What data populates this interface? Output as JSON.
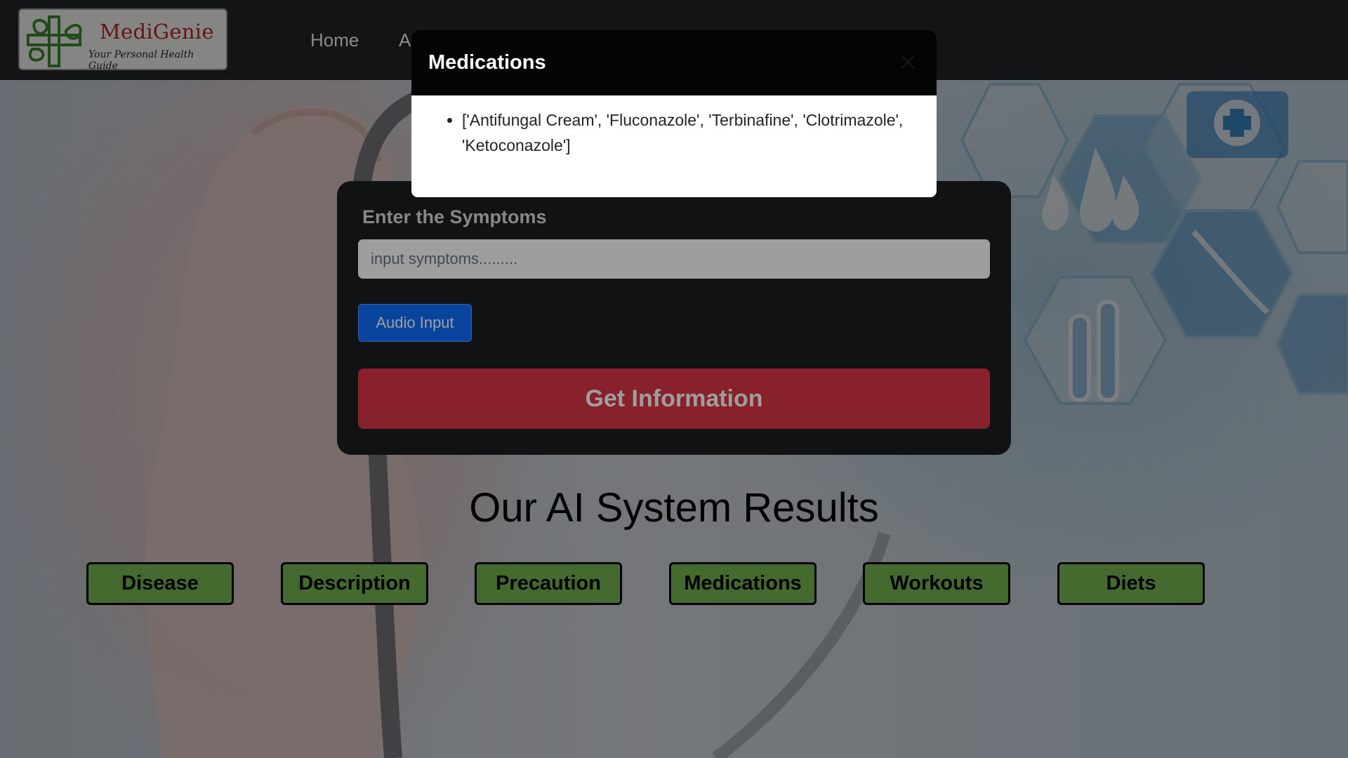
{
  "navbar": {
    "brand": "MediGenie",
    "tagline": "Your Personal Health Guide",
    "links": [
      "Home",
      "A"
    ]
  },
  "form": {
    "label": "Enter the Symptoms",
    "input_placeholder": "input symptoms.........",
    "input_value": "",
    "audio_button": "Audio Input",
    "submit_button": "Get Information"
  },
  "results": {
    "title": "Our AI System Results",
    "buttons": [
      "Disease",
      "Description",
      "Precaution",
      "Medications",
      "Workouts",
      "Diets"
    ]
  },
  "modal": {
    "title": "Medications",
    "close_icon": "close-icon",
    "items": [
      "['Antifungal Cream', 'Fluconazole', 'Terbinafine', 'Clotrimazole', 'Ketoconazole']"
    ]
  },
  "colors": {
    "navbar": "#212529",
    "primary": "#0d6efd",
    "danger": "#dc3545",
    "result_button": "#7cc158",
    "brand_red": "#b8262a",
    "logo_green": "#3c8a2e"
  }
}
